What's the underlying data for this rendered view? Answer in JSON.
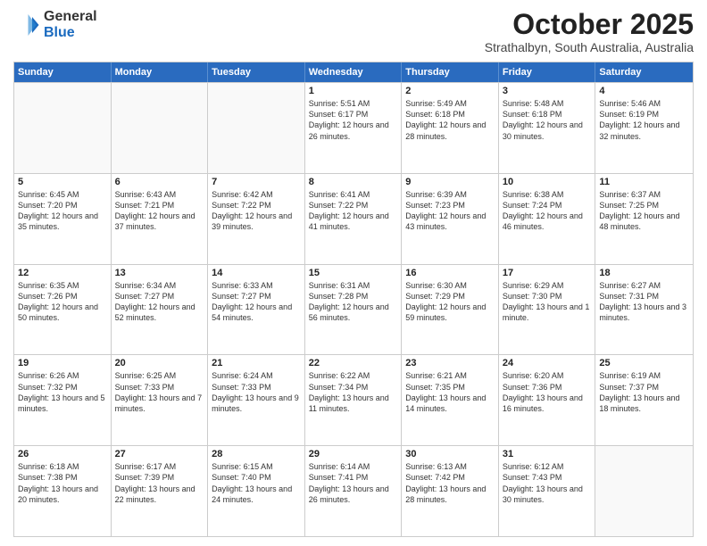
{
  "header": {
    "logo_general": "General",
    "logo_blue": "Blue",
    "month_title": "October 2025",
    "location": "Strathalbyn, South Australia, Australia"
  },
  "days_of_week": [
    "Sunday",
    "Monday",
    "Tuesday",
    "Wednesday",
    "Thursday",
    "Friday",
    "Saturday"
  ],
  "rows": [
    [
      {
        "day": "",
        "empty": true
      },
      {
        "day": "",
        "empty": true
      },
      {
        "day": "",
        "empty": true
      },
      {
        "day": "1",
        "sunrise": "5:51 AM",
        "sunset": "6:17 PM",
        "daylight": "12 hours and 26 minutes."
      },
      {
        "day": "2",
        "sunrise": "5:49 AM",
        "sunset": "6:18 PM",
        "daylight": "12 hours and 28 minutes."
      },
      {
        "day": "3",
        "sunrise": "5:48 AM",
        "sunset": "6:18 PM",
        "daylight": "12 hours and 30 minutes."
      },
      {
        "day": "4",
        "sunrise": "5:46 AM",
        "sunset": "6:19 PM",
        "daylight": "12 hours and 32 minutes."
      }
    ],
    [
      {
        "day": "5",
        "sunrise": "6:45 AM",
        "sunset": "7:20 PM",
        "daylight": "12 hours and 35 minutes."
      },
      {
        "day": "6",
        "sunrise": "6:43 AM",
        "sunset": "7:21 PM",
        "daylight": "12 hours and 37 minutes."
      },
      {
        "day": "7",
        "sunrise": "6:42 AM",
        "sunset": "7:22 PM",
        "daylight": "12 hours and 39 minutes."
      },
      {
        "day": "8",
        "sunrise": "6:41 AM",
        "sunset": "7:22 PM",
        "daylight": "12 hours and 41 minutes."
      },
      {
        "day": "9",
        "sunrise": "6:39 AM",
        "sunset": "7:23 PM",
        "daylight": "12 hours and 43 minutes."
      },
      {
        "day": "10",
        "sunrise": "6:38 AM",
        "sunset": "7:24 PM",
        "daylight": "12 hours and 46 minutes."
      },
      {
        "day": "11",
        "sunrise": "6:37 AM",
        "sunset": "7:25 PM",
        "daylight": "12 hours and 48 minutes."
      }
    ],
    [
      {
        "day": "12",
        "sunrise": "6:35 AM",
        "sunset": "7:26 PM",
        "daylight": "12 hours and 50 minutes."
      },
      {
        "day": "13",
        "sunrise": "6:34 AM",
        "sunset": "7:27 PM",
        "daylight": "12 hours and 52 minutes."
      },
      {
        "day": "14",
        "sunrise": "6:33 AM",
        "sunset": "7:27 PM",
        "daylight": "12 hours and 54 minutes."
      },
      {
        "day": "15",
        "sunrise": "6:31 AM",
        "sunset": "7:28 PM",
        "daylight": "12 hours and 56 minutes."
      },
      {
        "day": "16",
        "sunrise": "6:30 AM",
        "sunset": "7:29 PM",
        "daylight": "12 hours and 59 minutes."
      },
      {
        "day": "17",
        "sunrise": "6:29 AM",
        "sunset": "7:30 PM",
        "daylight": "13 hours and 1 minute."
      },
      {
        "day": "18",
        "sunrise": "6:27 AM",
        "sunset": "7:31 PM",
        "daylight": "13 hours and 3 minutes."
      }
    ],
    [
      {
        "day": "19",
        "sunrise": "6:26 AM",
        "sunset": "7:32 PM",
        "daylight": "13 hours and 5 minutes."
      },
      {
        "day": "20",
        "sunrise": "6:25 AM",
        "sunset": "7:33 PM",
        "daylight": "13 hours and 7 minutes."
      },
      {
        "day": "21",
        "sunrise": "6:24 AM",
        "sunset": "7:33 PM",
        "daylight": "13 hours and 9 minutes."
      },
      {
        "day": "22",
        "sunrise": "6:22 AM",
        "sunset": "7:34 PM",
        "daylight": "13 hours and 11 minutes."
      },
      {
        "day": "23",
        "sunrise": "6:21 AM",
        "sunset": "7:35 PM",
        "daylight": "13 hours and 14 minutes."
      },
      {
        "day": "24",
        "sunrise": "6:20 AM",
        "sunset": "7:36 PM",
        "daylight": "13 hours and 16 minutes."
      },
      {
        "day": "25",
        "sunrise": "6:19 AM",
        "sunset": "7:37 PM",
        "daylight": "13 hours and 18 minutes."
      }
    ],
    [
      {
        "day": "26",
        "sunrise": "6:18 AM",
        "sunset": "7:38 PM",
        "daylight": "13 hours and 20 minutes."
      },
      {
        "day": "27",
        "sunrise": "6:17 AM",
        "sunset": "7:39 PM",
        "daylight": "13 hours and 22 minutes."
      },
      {
        "day": "28",
        "sunrise": "6:15 AM",
        "sunset": "7:40 PM",
        "daylight": "13 hours and 24 minutes."
      },
      {
        "day": "29",
        "sunrise": "6:14 AM",
        "sunset": "7:41 PM",
        "daylight": "13 hours and 26 minutes."
      },
      {
        "day": "30",
        "sunrise": "6:13 AM",
        "sunset": "7:42 PM",
        "daylight": "13 hours and 28 minutes."
      },
      {
        "day": "31",
        "sunrise": "6:12 AM",
        "sunset": "7:43 PM",
        "daylight": "13 hours and 30 minutes."
      },
      {
        "day": "",
        "empty": true
      }
    ]
  ]
}
